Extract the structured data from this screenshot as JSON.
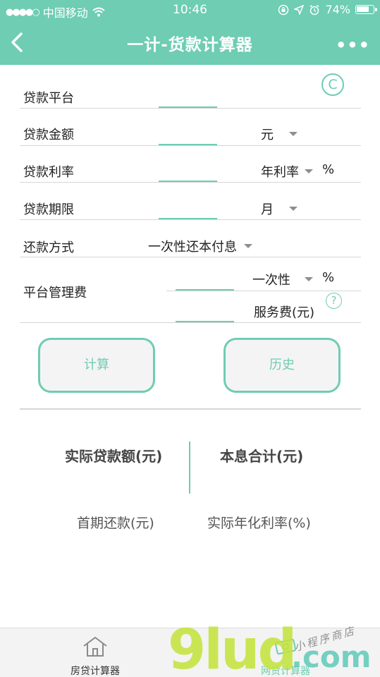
{
  "status_bar": {
    "carrier": "中国移动",
    "time": "10:46",
    "battery": "74%"
  },
  "nav": {
    "title": "一计-货款计算器",
    "more": "•••"
  },
  "colors": {
    "accent": "#6ecdb3",
    "caret": "#8e8e8e"
  },
  "form": {
    "platform_label": "贷款平台",
    "amount_label": "贷款金额",
    "amount_unit": "元",
    "rate_label": "贷款利率",
    "rate_type": "年利率",
    "rate_pct": "%",
    "term_label": "贷款期限",
    "term_unit": "月",
    "method_label": "还款方式",
    "method_value": "一次性还本付息",
    "fee_label": "平台管理费",
    "fee_type": "一次性",
    "fee_pct": "%",
    "service_fee_label": "服务费(元)",
    "c_icon": "C",
    "help_icon": "?"
  },
  "buttons": {
    "calculate": "计算",
    "history": "历史"
  },
  "results": {
    "actual_loan": "实际贷款额(元)",
    "total": "本息合计(元)",
    "first_payment": "首期还款(元)",
    "annual_rate": "实际年化利率(%)"
  },
  "tabs": [
    {
      "label": "房贷计算器",
      "icon": "house-icon"
    },
    {
      "label": "网贷计算器",
      "icon": "cash-icon"
    }
  ],
  "watermark": {
    "main": "9lud",
    "com": ".com",
    "small": "小程序商店"
  }
}
